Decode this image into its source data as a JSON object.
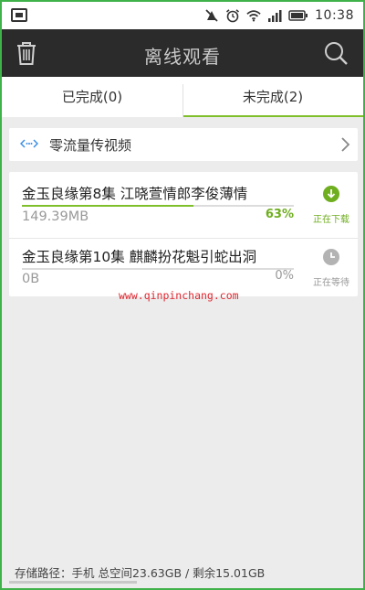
{
  "status_bar": {
    "time": "10:38",
    "icons": [
      "image-icon",
      "mute-icon",
      "alarm-icon",
      "wifi-icon",
      "signal-icon",
      "battery-icon"
    ]
  },
  "header": {
    "title": "离线观看",
    "left_icon": "trash-icon",
    "right_icon": "search-icon"
  },
  "tabs": [
    {
      "label": "已完成(0)",
      "active": false
    },
    {
      "label": "未完成(2)",
      "active": true
    }
  ],
  "zero_traffic": {
    "label": "零流量传视频",
    "icon": "share-dots-icon"
  },
  "downloads": [
    {
      "title": "金玉良缘第8集  江晓萱情郎李俊薄情",
      "size": "149.39MB",
      "percent_text": "63%",
      "progress": 0.63,
      "status": "正在下载",
      "status_icon": "download-icon",
      "status_color": "#6fae1f"
    },
    {
      "title": "金玉良缘第10集  麒麟扮花魁引蛇出洞",
      "size": "0B",
      "percent_text": "0%",
      "progress": 0,
      "status": "正在等待",
      "status_icon": "clock-icon",
      "status_color": "#999999"
    }
  ],
  "watermark": "www.qinpinchang.com",
  "storage": {
    "text": "存储路径：手机 总空间23.63GB / 剩余15.01GB"
  },
  "colors": {
    "accent": "#7fbf2b",
    "header_bg": "#2b2b2b",
    "frame": "#3fb24a"
  }
}
